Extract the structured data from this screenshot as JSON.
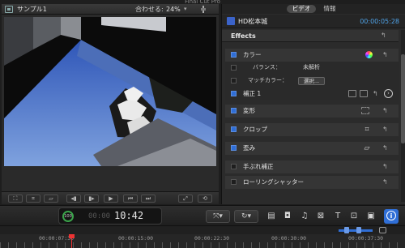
{
  "app": {
    "title": "Final Cut Pro"
  },
  "viewer": {
    "title": "サンプル1",
    "fit_label": "合わせる:",
    "zoom_value": "24%",
    "transport_buttons": [
      {
        "icon": "transform-icon"
      },
      {
        "icon": "crop-icon"
      },
      {
        "icon": "distort-icon"
      },
      {
        "icon": "previous-frame-icon"
      },
      {
        "icon": "play-icon"
      },
      {
        "icon": "go-to-start-icon"
      },
      {
        "icon": "go-to-end-icon"
      },
      {
        "icon": "fullscreen-icon"
      },
      {
        "icon": "loop-icon"
      }
    ]
  },
  "inspector": {
    "tabs": {
      "video": "ビデオ",
      "info": "情報"
    },
    "clip_name": "HD松本城",
    "clip_duration": "00:00:05:28",
    "section_title": "Effects",
    "rows": {
      "color": "カラー",
      "balance_label": "バランス：",
      "balance_value": "未解析",
      "match_color_label": "マッチカラー：",
      "match_color_button": "選択...",
      "correction": "補正 1",
      "transform": "変形",
      "crop": "クロップ",
      "distort": "歪み",
      "stabilization": "手ぶれ補正",
      "rolling_shutter": "ローリングシャッター"
    }
  },
  "toolbar": {
    "timecode": "10:42",
    "timecode_dim": "00:00",
    "gauge_label": "100"
  },
  "timeline": {
    "ticks": [
      "00:00:07:30",
      "00:00:15:00",
      "00:00:22:30",
      "00:00:30:00",
      "00:00:37:30"
    ]
  },
  "colors": {
    "accent": "#2f6ed6",
    "timecode_blue": "#4fa3e8",
    "playhead": "#ee3333"
  }
}
